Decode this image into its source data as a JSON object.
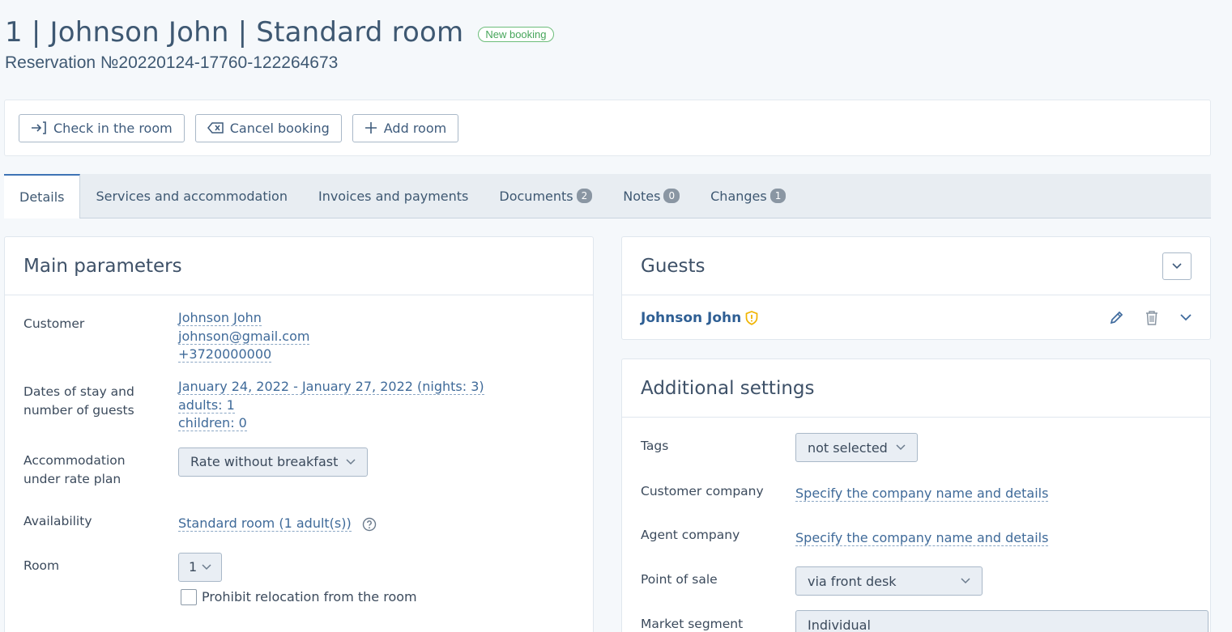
{
  "header": {
    "title": "1 | Johnson John | Standard room",
    "status_badge": "New booking",
    "reservation": "Reservation №20220124-17760-122264673"
  },
  "toolbar": {
    "check_in": "Check in the room",
    "cancel": "Cancel booking",
    "add_room": "Add room"
  },
  "tabs": {
    "details": "Details",
    "services": "Services and accommodation",
    "invoices": "Invoices and payments",
    "documents": "Documents",
    "documents_count": "2",
    "notes": "Notes",
    "notes_count": "0",
    "changes": "Changes",
    "changes_count": "1"
  },
  "main": {
    "title": "Main parameters",
    "customer_label": "Customer",
    "customer_name": "Johnson John",
    "customer_email": "johnson@gmail.com",
    "customer_phone": "+3720000000",
    "dates_label_1": "Dates of stay and",
    "dates_label_2": "number of guests",
    "dates_value": "January 24, 2022 - January 27, 2022 (nights: 3)",
    "adults": "adults: 1",
    "children": "children: 0",
    "rate_label_1": "Accommodation",
    "rate_label_2": "under rate plan",
    "rate_value": "Rate without breakfast",
    "availability_label": "Availability",
    "availability_value": "Standard room (1 adult(s))",
    "room_label": "Room",
    "room_value": "1",
    "prohibit_relocation": "Prohibit relocation from the room"
  },
  "guests": {
    "title": "Guests",
    "guest_name": "Johnson John"
  },
  "settings": {
    "title": "Additional settings",
    "tags_label": "Tags",
    "tags_value": "not selected",
    "customer_company_label": "Customer company",
    "customer_company_value": "Specify the company name and details",
    "agent_company_label": "Agent company",
    "agent_company_value": "Specify the company name and details",
    "pos_label": "Point of sale",
    "pos_value": "via front desk",
    "segment_label": "Market segment",
    "segment_value": "Individual"
  },
  "colors": {
    "accent": "#3e73b5",
    "badge_green": "#46a55a",
    "warning": "#f0b400"
  }
}
